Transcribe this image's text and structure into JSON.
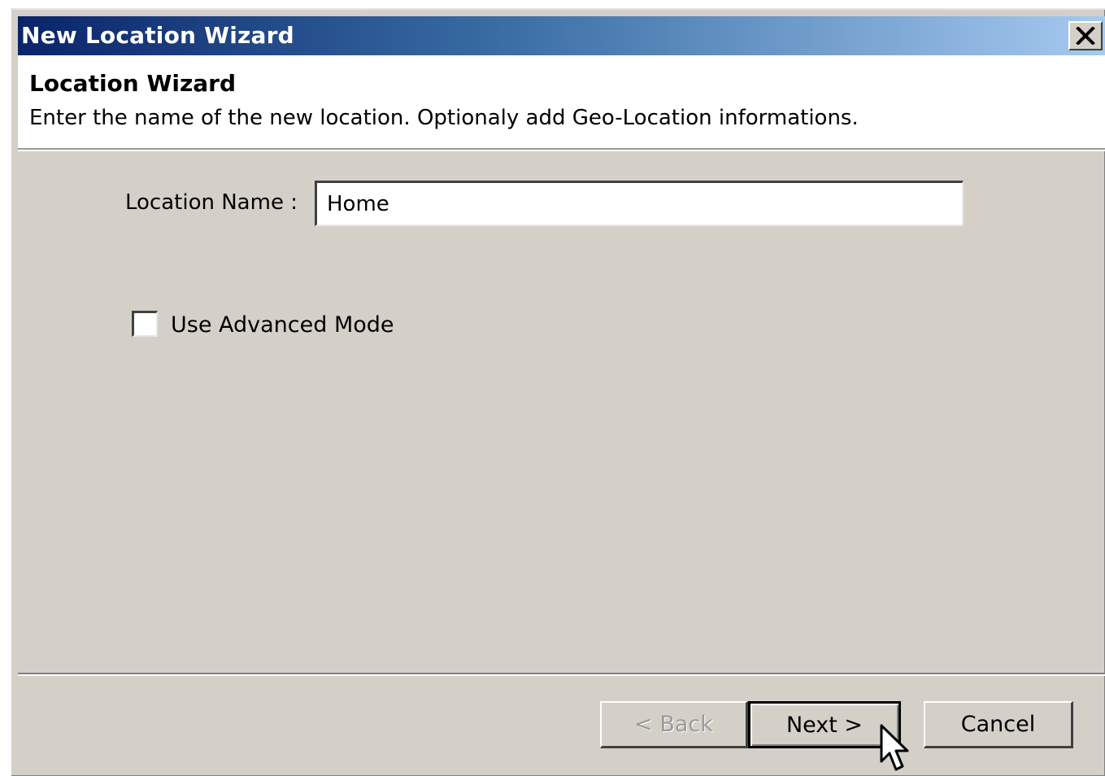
{
  "window": {
    "title": "New Location Wizard",
    "close_label": "×"
  },
  "header": {
    "title": "Location Wizard",
    "description": "Enter the name of the new location. Optionaly add Geo-Location informations."
  },
  "form": {
    "location_name_label": "Location Name :",
    "location_name_value": "Home",
    "advanced_mode_label": "Use Advanced Mode",
    "advanced_mode_checked": false
  },
  "buttons": {
    "back_label": "< Back",
    "next_label": "Next >",
    "cancel_label": "Cancel",
    "back_enabled": false
  },
  "icons": {
    "close": "close-icon",
    "cursor": "mouse-pointer-icon"
  }
}
